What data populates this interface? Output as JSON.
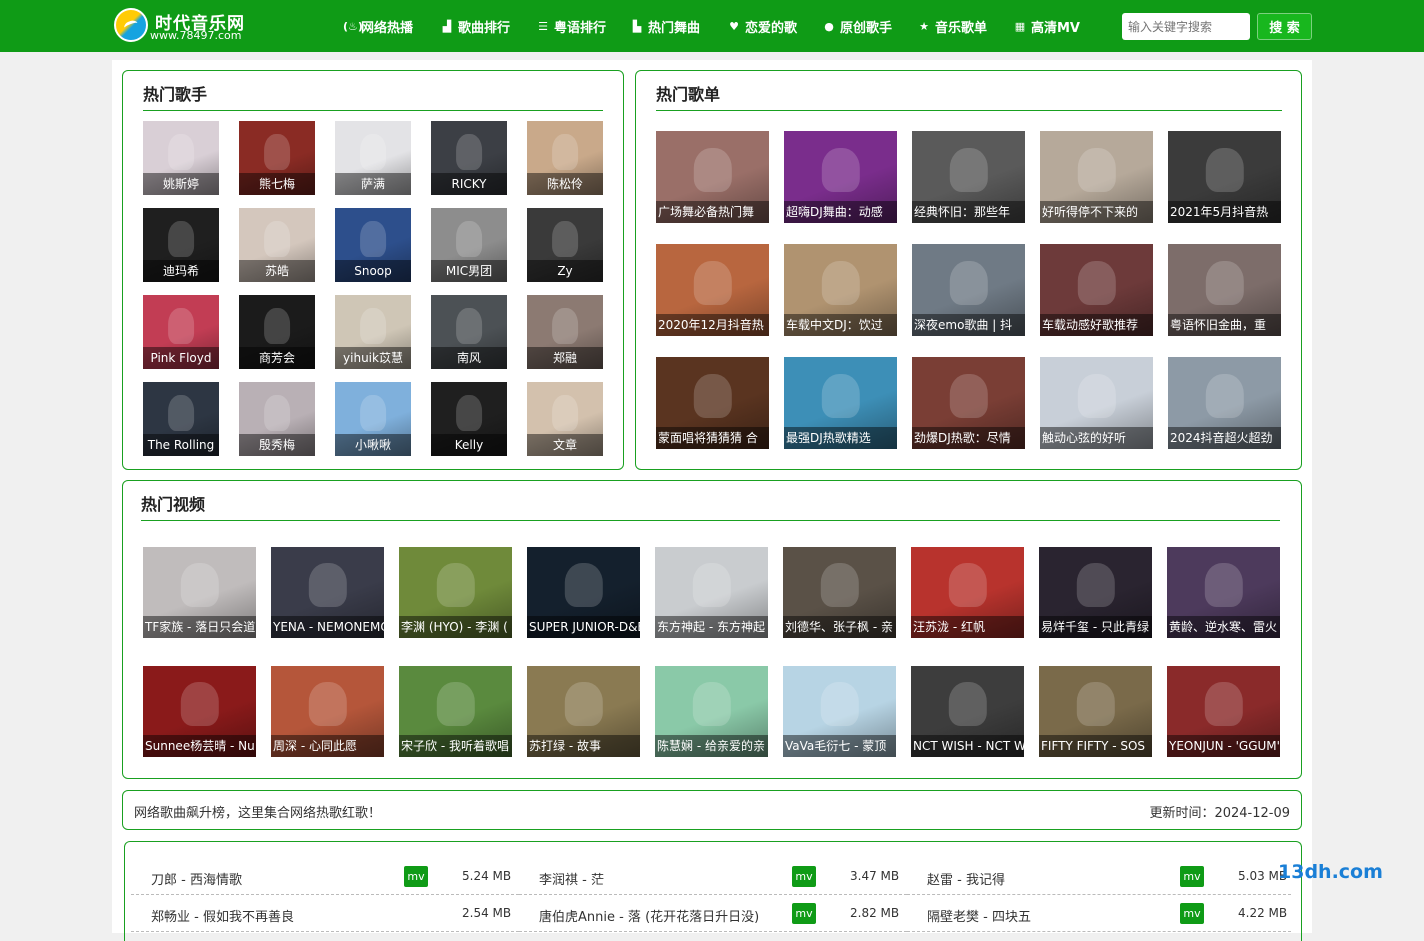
{
  "site": {
    "title": "时代音乐网",
    "url": "www.78497.com",
    "brand_color": "#0f9b16"
  },
  "nav": [
    {
      "label": "网络热播",
      "icon": "fire-icon",
      "glyph": "(♨)"
    },
    {
      "label": "歌曲排行",
      "icon": "chart-icon",
      "glyph": "▟"
    },
    {
      "label": "粤语排行",
      "icon": "list-icon",
      "glyph": "☰"
    },
    {
      "label": "热门舞曲",
      "icon": "bar-chart-icon",
      "glyph": "▙"
    },
    {
      "label": "恋爱的歌",
      "icon": "heart-icon",
      "glyph": "♥"
    },
    {
      "label": "原创歌手",
      "icon": "user-icon",
      "glyph": "●"
    },
    {
      "label": "音乐歌单",
      "icon": "star-icon",
      "glyph": "★"
    },
    {
      "label": "高清MV",
      "icon": "film-icon",
      "glyph": "▦"
    }
  ],
  "search": {
    "placeholder": "输入关键字搜索",
    "button": "搜 索"
  },
  "singers": {
    "title": "热门歌手",
    "items": [
      {
        "name": "姚斯婷",
        "color": "#d9cfd6"
      },
      {
        "name": "熊七梅",
        "color": "#8a2b24"
      },
      {
        "name": "萨满",
        "color": "#e3e3e6"
      },
      {
        "name": "RICKY",
        "color": "#3c3f45"
      },
      {
        "name": "陈松伶",
        "color": "#c9a98a"
      },
      {
        "name": "迪玛希",
        "color": "#1f1f1f"
      },
      {
        "name": "苏皓",
        "color": "#d4c7bd"
      },
      {
        "name": "Snoop",
        "color": "#2d4f8c"
      },
      {
        "name": "MIC男团",
        "color": "#8d8d8d"
      },
      {
        "name": "Zy",
        "color": "#3a3a3a"
      },
      {
        "name": "Pink Floyd",
        "color": "#c23d54"
      },
      {
        "name": "商芳会",
        "color": "#1b1b1b"
      },
      {
        "name": "yihuik苡慧",
        "color": "#cfc6b6"
      },
      {
        "name": "南风",
        "color": "#4c5155"
      },
      {
        "name": "郑融",
        "color": "#8c7a72"
      },
      {
        "name": "The Rolling",
        "color": "#2d3643"
      },
      {
        "name": "殷秀梅",
        "color": "#b9b0b5"
      },
      {
        "name": "小啾啾",
        "color": "#7fb0dc"
      },
      {
        "name": "Kelly",
        "color": "#1f1f1f"
      },
      {
        "name": "文章",
        "color": "#d3c1ad"
      }
    ]
  },
  "playlists": {
    "title": "热门歌单",
    "items": [
      {
        "name": "广场舞必备热门舞",
        "color": "#9a6f68"
      },
      {
        "name": "超嗨DJ舞曲：动感",
        "color": "#7a2d8c"
      },
      {
        "name": "经典怀旧：那些年",
        "color": "#5a5a5a"
      },
      {
        "name": "好听得停不下来的",
        "color": "#b6a99a"
      },
      {
        "name": "2021年5月抖音热",
        "color": "#3b3b3b"
      },
      {
        "name": "2020年12月抖音热",
        "color": "#b8663f"
      },
      {
        "name": "车载中文DJ：饮过",
        "color": "#b09370"
      },
      {
        "name": "深夜emo歌曲 | 抖",
        "color": "#6f7a85"
      },
      {
        "name": "车载动感好歌推荐",
        "color": "#6d3a3a"
      },
      {
        "name": "粤语怀旧金曲，重",
        "color": "#7d6d6a"
      },
      {
        "name": "蒙面唱将猜猜猜 合",
        "color": "#5a3420"
      },
      {
        "name": "最强DJ热歌精选",
        "color": "#3d8fb7"
      },
      {
        "name": "劲爆DJ热歌：尽情",
        "color": "#7a3e35"
      },
      {
        "name": "触动心弦的好听",
        "color": "#c8cfd8"
      },
      {
        "name": "2024抖音超火超劲",
        "color": "#8d9aa6"
      }
    ]
  },
  "videos": {
    "title": "热门视频",
    "items": [
      {
        "name": "TF家族 - 落日只会道",
        "color": "#c0bcbc"
      },
      {
        "name": "YENA - NEMONEMO",
        "color": "#3a3c4a"
      },
      {
        "name": "李渊 (HYO) - 李渊 (",
        "color": "#6f8a3a"
      },
      {
        "name": "SUPER JUNIOR-D&E",
        "color": "#14202d"
      },
      {
        "name": "东方神起 - 东方神起",
        "color": "#c9cccf"
      },
      {
        "name": "刘德华、张子枫 - 亲",
        "color": "#5a5147"
      },
      {
        "name": "汪苏泷 - 红帆",
        "color": "#b8332d"
      },
      {
        "name": "易烊千玺 - 只此青绿",
        "color": "#2a2430"
      },
      {
        "name": "黄龄、逆水寒、雷火",
        "color": "#4d3a5c"
      },
      {
        "name": "Sunnee杨芸晴 - Nu",
        "color": "#8a1a1a"
      },
      {
        "name": "周深 - 心同此愿",
        "color": "#b5563a"
      },
      {
        "name": "宋子欣 - 我听着歌唱",
        "color": "#5a8a3e"
      },
      {
        "name": "苏打绿 - 故事",
        "color": "#8a7a52"
      },
      {
        "name": "陈慧娴 - 给亲爱的亲",
        "color": "#8ac9a8"
      },
      {
        "name": "VaVa毛衍七 - 蒙顶",
        "color": "#b7d4e4"
      },
      {
        "name": "NCT WISH - NCT W",
        "color": "#3d3d3d"
      },
      {
        "name": "FIFTY FIFTY - SOS",
        "color": "#7a6a4a"
      },
      {
        "name": "YEONJUN - 'GGUM'",
        "color": "#8a2a2a"
      }
    ]
  },
  "notice": {
    "text": "网络歌曲飙升榜，这里集合网络热歌红歌！",
    "updated": "更新时间：2024-12-09"
  },
  "songs": [
    [
      {
        "title": "刀郎 - 西海情歌",
        "mv": "mv",
        "size": "5.24 MB"
      },
      {
        "title": "李润祺 - 茫",
        "mv": "mv",
        "size": "3.47 MB"
      },
      {
        "title": "赵雷 - 我记得",
        "mv": "mv",
        "size": "5.03 MB"
      }
    ],
    [
      {
        "title": "郑畅业 - 假如我不再善良",
        "mv": "",
        "size": "2.54 MB"
      },
      {
        "title": "唐伯虎Annie - 落 (花开花落日升日没)",
        "mv": "mv",
        "size": "2.82 MB"
      },
      {
        "title": "隔壁老樊 - 四块五",
        "mv": "mv",
        "size": "4.22 MB"
      }
    ]
  ],
  "watermark": "13dh.com"
}
